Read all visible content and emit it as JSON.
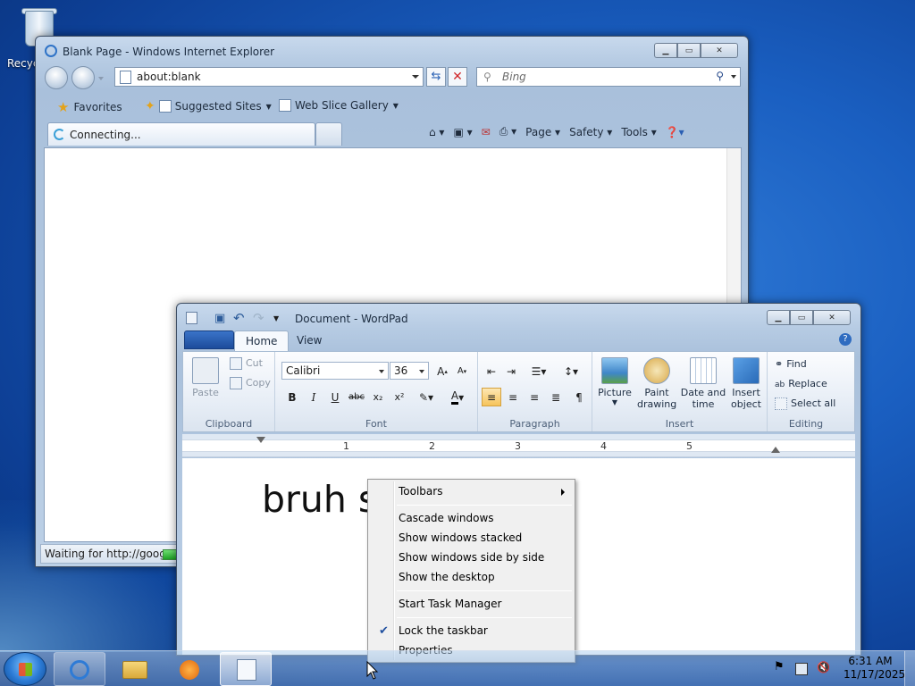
{
  "desktop": {
    "recycle_bin_label": "Recyc"
  },
  "ie": {
    "title": "Blank Page - Windows Internet Explorer",
    "address": "about:blank",
    "search_placeholder": "Bing",
    "favorites": "Favorites",
    "suggested_sites": "Suggested Sites",
    "web_slice_gallery": "Web Slice Gallery",
    "tab_label": "Connecting...",
    "menu_page": "Page",
    "menu_safety": "Safety",
    "menu_tools": "Tools",
    "status_text": "Waiting for http://goog"
  },
  "wordpad": {
    "title": "Document - WordPad",
    "tabs": {
      "home": "Home",
      "view": "View"
    },
    "clipboard": {
      "paste": "Paste",
      "cut": "Cut",
      "copy": "Copy",
      "group": "Clipboard"
    },
    "font": {
      "family": "Calibri",
      "size": "36",
      "group": "Font"
    },
    "paragraph": {
      "group": "Paragraph"
    },
    "insert": {
      "picture": "Picture",
      "paint_line1": "Paint",
      "paint_line2": "drawing",
      "date_line1": "Date and",
      "date_line2": "time",
      "object_line1": "Insert",
      "object_line2": "object",
      "group": "Insert"
    },
    "editing": {
      "find": "Find",
      "replace": "Replace",
      "select_all": "Select all",
      "group": "Editing"
    },
    "ruler": [
      "1",
      "2",
      "3",
      "4",
      "5"
    ],
    "document_text": "bruh s"
  },
  "context_menu": {
    "toolbars": "Toolbars",
    "cascade": "Cascade windows",
    "stacked": "Show windows stacked",
    "side_by_side": "Show windows side by side",
    "show_desktop": "Show the desktop",
    "task_manager": "Start Task Manager",
    "lock_taskbar": "Lock the taskbar",
    "lock_checked": true,
    "properties": "Properties"
  },
  "taskbar": {
    "time": "6:31 AM",
    "date": "11/17/2025"
  },
  "colors": {
    "accent": "#1d4c9b",
    "selection": "#f6c35b"
  }
}
